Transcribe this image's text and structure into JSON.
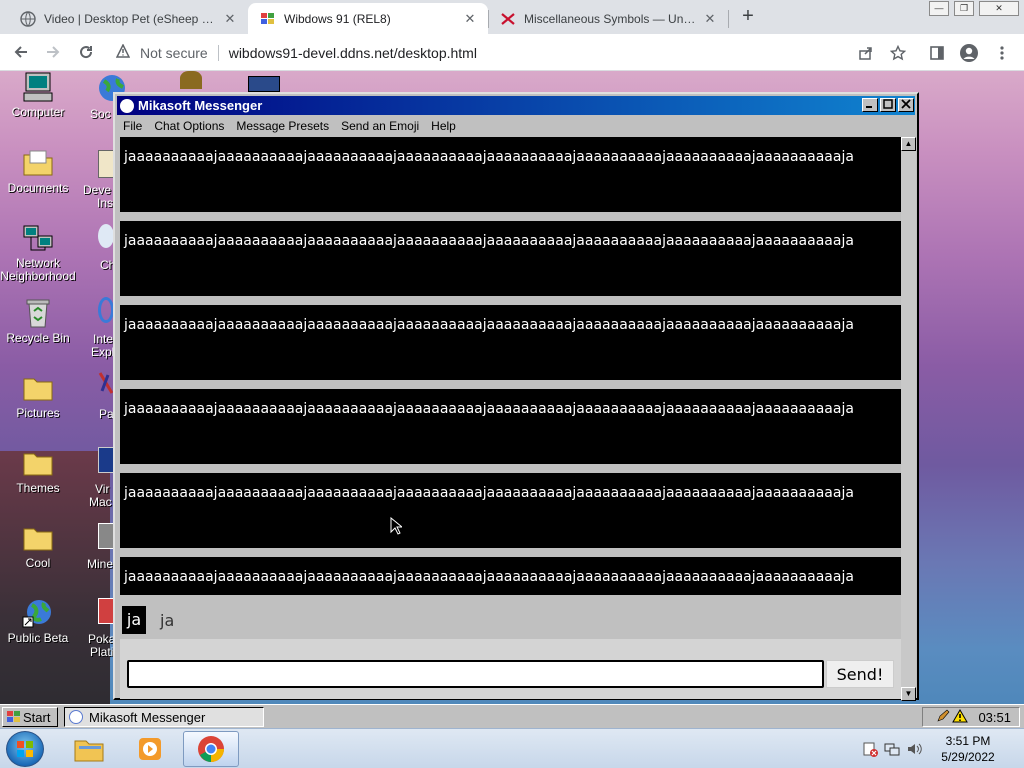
{
  "browser": {
    "tabs": [
      {
        "title": "Video | Desktop Pet (eSheep 64b",
        "close": "✕",
        "active": false
      },
      {
        "title": "Wibdows 91 (REL8)",
        "close": "✕",
        "active": true
      },
      {
        "title": "Miscellaneous Symbols — Unico",
        "close": "✕",
        "active": false
      }
    ],
    "new_tab": "+",
    "window_controls": {
      "minimize": "—",
      "restore": "❐",
      "close": "✕"
    },
    "security_label": "Not secure",
    "url": "wibdows91-devel.ddns.net/desktop.html"
  },
  "desktop": {
    "icons": [
      {
        "label": "Computer"
      },
      {
        "label": "Documents"
      },
      {
        "label": "Network Neighborhood"
      },
      {
        "label": "Recycle Bin"
      },
      {
        "label": "Pictures"
      },
      {
        "label": "Themes"
      },
      {
        "label": "Cool"
      },
      {
        "label": "Public Beta"
      }
    ],
    "partial_labels": [
      "Soc",
      "Deve",
      "Ins",
      "Ch",
      "Inte",
      "Expl",
      "Pa",
      "Vir",
      "Mac",
      "Mine",
      "Poka",
      "Plati"
    ]
  },
  "messenger": {
    "title": "Mikasoft Messenger",
    "menu": [
      "File",
      "Chat Options",
      "Message Presets",
      "Send an Emoji",
      "Help"
    ],
    "messages": [
      "jaaaaaaaaaajaaaaaaaaaajaaaaaaaaaajaaaaaaaaaajaaaaaaaaaajaaaaaaaaaajaaaaaaaaaajaaaaaaaaaaja",
      "jaaaaaaaaaajaaaaaaaaaajaaaaaaaaaajaaaaaaaaaajaaaaaaaaaajaaaaaaaaaajaaaaaaaaaajaaaaaaaaaaja",
      "jaaaaaaaaaajaaaaaaaaaajaaaaaaaaaajaaaaaaaaaajaaaaaaaaaajaaaaaaaaaajaaaaaaaaaajaaaaaaaaaaja",
      "jaaaaaaaaaajaaaaaaaaaajaaaaaaaaaajaaaaaaaaaajaaaaaaaaaajaaaaaaaaaajaaaaaaaaaajaaaaaaaaaaja",
      "jaaaaaaaaaajaaaaaaaaaajaaaaaaaaaajaaaaaaaaaajaaaaaaaaaajaaaaaaaaaajaaaaaaaaaajaaaaaaaaaaja",
      "jaaaaaaaaaajaaaaaaaaaajaaaaaaaaaajaaaaaaaaaajaaaaaaaaaajaaaaaaaaaajaaaaaaaaaajaaaaaaaaaaja"
    ],
    "user_avatar": "ja",
    "user_name": "ja",
    "input_value": "",
    "send_label": "Send!"
  },
  "w91_taskbar": {
    "start_label": "Start",
    "task_label": "Mikasoft Messenger",
    "clock": "03:51"
  },
  "win7_taskbar": {
    "time": "3:51 PM",
    "date": "5/29/2022"
  },
  "colors": {
    "titlebar_start": "#000080",
    "titlebar_end": "#1084d0",
    "chat_bg": "#000000"
  }
}
